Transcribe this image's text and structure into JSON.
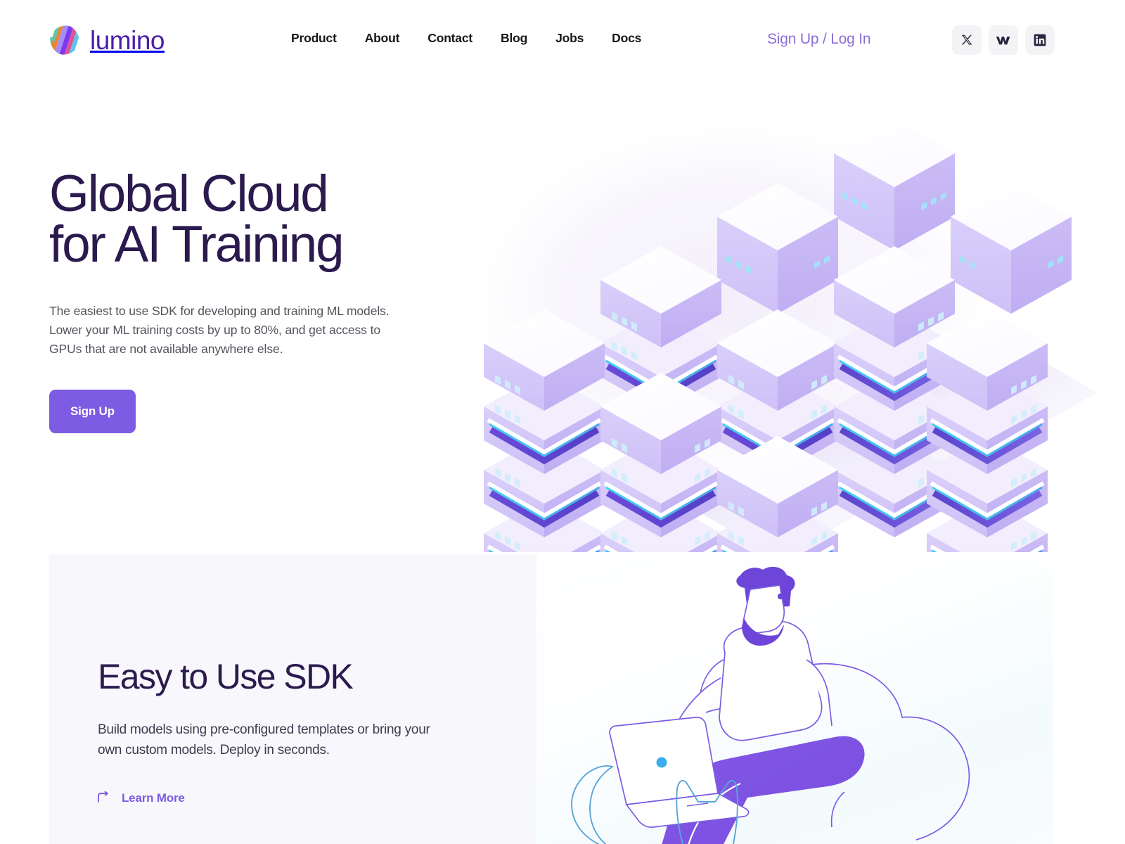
{
  "brand": {
    "name": "lumino",
    "logo_icon": "lumino-stripes-logo",
    "logo_colors": [
      "#5ec9a6",
      "#e8873a",
      "#8b5cf6",
      "#e0529b",
      "#5bc6e8"
    ],
    "word_color": "#4b1fa8"
  },
  "nav": {
    "items": [
      {
        "label": "Product",
        "name": "nav-product"
      },
      {
        "label": "About",
        "name": "nav-about"
      },
      {
        "label": "Contact",
        "name": "nav-contact"
      },
      {
        "label": "Blog",
        "name": "nav-blog"
      },
      {
        "label": "Jobs",
        "name": "nav-jobs"
      },
      {
        "label": "Docs",
        "name": "nav-docs"
      }
    ],
    "auth_label": "Sign Up / Log In",
    "auth_color": "#8b6fd8"
  },
  "socials": [
    {
      "name": "x-twitter-icon",
      "label": "X"
    },
    {
      "name": "webflow-w-icon",
      "label": "W"
    },
    {
      "name": "linkedin-icon",
      "label": "in"
    }
  ],
  "hero": {
    "title": "Global Cloud\nfor AI Training",
    "subtitle": "The easiest to use SDK for developing and training ML models. Lower your ML training costs by up to 80%, and get access to GPUs that are not available anywhere else.",
    "cta_label": "Sign Up",
    "cta_color": "#7d5ce3",
    "title_color": "#2b1a4d",
    "illustration": "isometric-server-racks"
  },
  "sdk_section": {
    "title": "Easy to Use SDK",
    "subtitle": "Build models using pre-configured templates or bring your own custom models. Deploy in seconds.",
    "link_label": "Learn More",
    "link_icon": "arrow-turn-right-icon",
    "link_color": "#7d5ce3",
    "panel_bg": "#f8f8fc",
    "illustration": "person-with-laptop-in-beanbag-and-cat"
  }
}
